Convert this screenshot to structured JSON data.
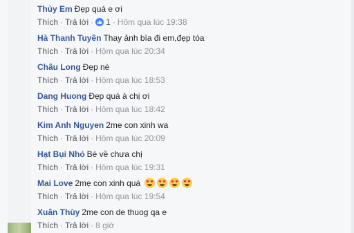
{
  "comments": [
    {
      "author": "Thủy Em",
      "text": "Đẹp quá e ơi",
      "like_label": "Thích",
      "reply_label": "Trả lời",
      "reaction_count": "1",
      "time": "Hôm qua lúc 19:38"
    },
    {
      "author": "Hà Thanh Tuyền",
      "text": "Thay ảnh bìa đi em,đẹp tóa",
      "like_label": "Thích",
      "reply_label": "Trả lời",
      "time": "Hôm qua lúc 20:34"
    },
    {
      "author": "Châu Long",
      "text": "Đẹp nè",
      "like_label": "Thích",
      "reply_label": "Trả lời",
      "time": "Hôm qua lúc 18:53"
    },
    {
      "author": "Dang Huong",
      "text": "Đẹp quá à chị ơi",
      "like_label": "Thích",
      "reply_label": "Trả lời",
      "time": "Hôm qua lúc 18:42"
    },
    {
      "author": "Kim Anh Nguyen",
      "text": "2me con xinh wa",
      "like_label": "Thích",
      "reply_label": "Trả lời",
      "time": "Hôm qua lúc 20:09"
    },
    {
      "author": "Hạt Bụi Nhỏ",
      "text": "Bé về chưa chị",
      "like_label": "Thích",
      "reply_label": "Trả lời",
      "time": "Hôm qua lúc 19:31"
    },
    {
      "author": "Mai Love",
      "text": "2mẹ con xinh quá",
      "emojis": [
        "heart-eyes-emoji",
        "heart-eyes-emoji",
        "heart-eyes-emoji",
        "heart-eyes-emoji"
      ],
      "like_label": "Thích",
      "reply_label": "Trả lời",
      "time": "Hôm qua lúc 19:54"
    },
    {
      "author": "Xuân Thùy",
      "text": "2me con de thuog qa e",
      "like_label": "Thích",
      "reply_label": "Trả lời",
      "time": "8 giờ"
    }
  ],
  "colors": {
    "author": "#365899",
    "meta": "#90949c",
    "action": "#4b4f56",
    "like_badge": "#4080ff"
  }
}
